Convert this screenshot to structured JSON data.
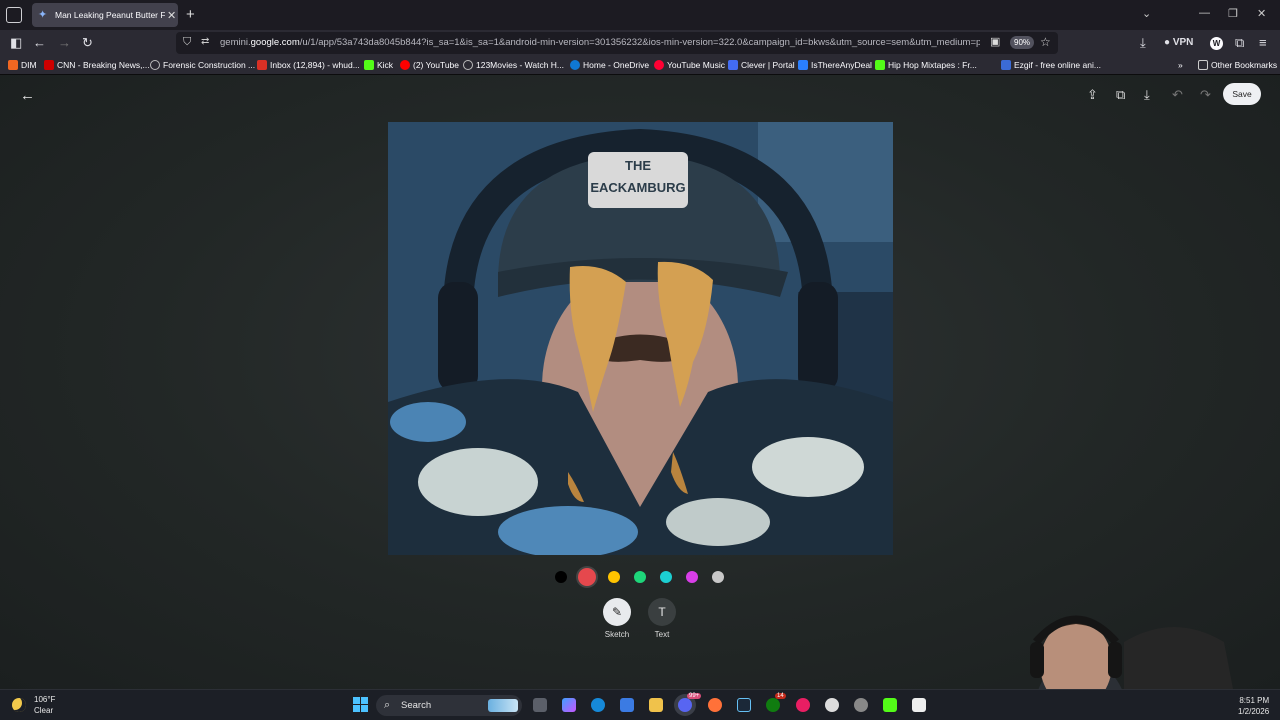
{
  "browser": {
    "tab_title": "Man Leaking Peanut Butter From",
    "url_prefix": "gemini.",
    "url_domain": "google.com",
    "url_rest": "/u/1/app/53a743da8045b844?is_sa=1&is_sa=1&android-min-version=301356232&ios-min-version=322.0&campaign_id=bkws&utm_source=sem&utm_medium=paid-",
    "zoom": "90%",
    "vpn_label": "VPN",
    "profile_initial": "W"
  },
  "bookmarks": [
    {
      "label": "DIM",
      "icon": "dim-icon",
      "color": "#f26722"
    },
    {
      "label": "CNN - Breaking News,...",
      "icon": "cnn-icon",
      "color": "#cc0000"
    },
    {
      "label": "Forensic Construction ...",
      "icon": "globe-icon",
      "color": "#6a6a75"
    },
    {
      "label": "Inbox (12,894) - whud...",
      "icon": "gmail-icon",
      "color": "#d93025"
    },
    {
      "label": "Kick",
      "icon": "kick-icon",
      "color": "#53fc18"
    },
    {
      "label": "(2) YouTube",
      "icon": "youtube-icon",
      "color": "#ff0000"
    },
    {
      "label": "123Movies - Watch H...",
      "icon": "globe-icon",
      "color": "#6a6a75"
    },
    {
      "label": "Home - OneDrive",
      "icon": "onedrive-icon",
      "color": "#0f78d4"
    },
    {
      "label": "YouTube Music",
      "icon": "youtube-music-icon",
      "color": "#ff0033"
    },
    {
      "label": "Clever | Portal",
      "icon": "clever-icon",
      "color": "#436cf2"
    },
    {
      "label": "IsThereAnyDeal",
      "icon": "itad-icon",
      "color": "#2a7fff"
    },
    {
      "label": "Hip Hop Mixtapes : Fr...",
      "icon": "kick-icon",
      "color": "#53fc18"
    },
    {
      "label": "Ezgif - free online ani...",
      "icon": "ezgif-icon",
      "color": "#3b6bd6"
    }
  ],
  "bookmarks_other": "Other Bookmarks",
  "editor": {
    "save_label": "Save",
    "colors": [
      "#000000",
      "#e5484d",
      "#ffc400",
      "#1ed67a",
      "#1ccfd2",
      "#d83ee8",
      "#c8c8c8"
    ],
    "selected_color_index": 1,
    "modes": [
      {
        "label": "Sketch",
        "icon": "sketch-icon"
      },
      {
        "label": "Text",
        "icon": "text-icon"
      }
    ],
    "selected_mode": "Sketch"
  },
  "photo": {
    "cap_text_line1": "THE",
    "cap_text_line2": "EACKAMBURG"
  },
  "taskbar": {
    "temp": "106°F",
    "condition": "Clear",
    "search_placeholder": "Search",
    "time": "8:51 PM",
    "date": "1/2/2026",
    "discord_badge": "99+",
    "xbox_badge": "14"
  }
}
